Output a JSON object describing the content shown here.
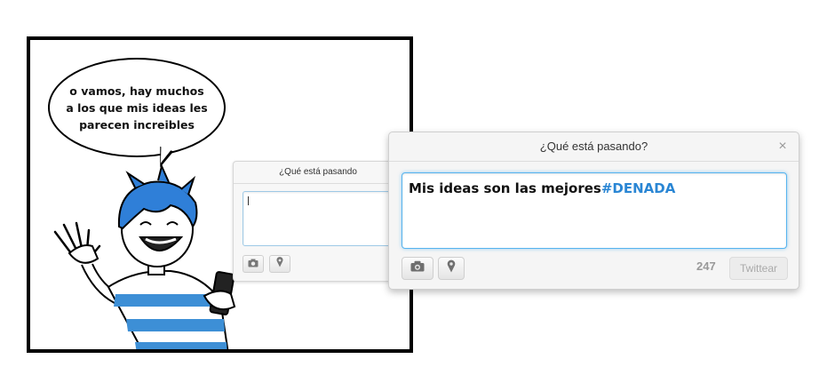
{
  "comic": {
    "speech_lines": [
      "o vamos, hay muchos",
      "a los que mis ideas les",
      "parecen increibles"
    ]
  },
  "mini_box": {
    "title": "¿Qué está pasando"
  },
  "dialog": {
    "title": "¿Qué está pasando?",
    "close_label": "×",
    "tweet_text": "Mis ideas son las mejores",
    "hashtag": "#DENADA",
    "char_counter": "247",
    "tweet_button": "Twittear"
  },
  "icons": {
    "camera": "camera-icon",
    "location": "map-pin-icon",
    "close": "close-icon"
  },
  "colors": {
    "hashtag": "#2a86d4",
    "focus_border": "#56b4ef",
    "shirt_stripe": "#3d8fd6",
    "hair": "#2f7fd8"
  }
}
